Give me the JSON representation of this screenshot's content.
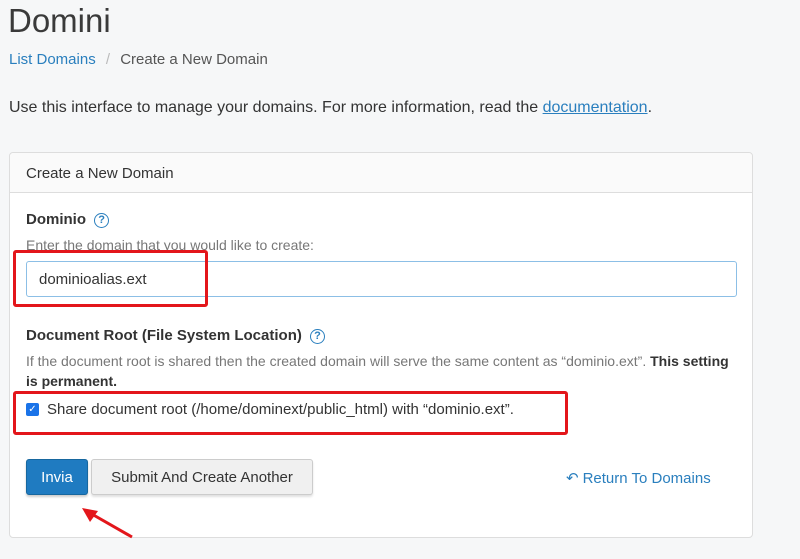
{
  "page": {
    "title": "Domini"
  },
  "breadcrumb": {
    "parent_label": "List Domains",
    "separator": "/",
    "current_label": "Create a New Domain"
  },
  "intro": {
    "text": "Use this interface to manage your domains. For more information, read the",
    "link_label": "documentation",
    "suffix": "."
  },
  "panel": {
    "heading": "Create a New Domain",
    "domain": {
      "label": "Dominio",
      "help_icon": "question-circle-icon",
      "help_text": "Enter the domain that you would like to create:",
      "value": "dominioalias.ext"
    },
    "docroot": {
      "label": "Document Root (File System Location)",
      "help_icon": "question-circle-icon",
      "help_text": "If the document root is shared then the created domain will serve the same content as “dominio.ext”.",
      "help_strong": "This setting is permanent.",
      "share_checked": true,
      "share_label": "Share document root (/home/dominext/public_html) with “dominio.ext”."
    },
    "actions": {
      "submit_label": "Invia",
      "submit_another_label": "Submit And Create Another",
      "return_label": "Return To Domains",
      "return_icon": "undo-arrow-icon"
    }
  },
  "colors": {
    "link": "#2a7fbe",
    "primary_button": "#1f7bc1",
    "annotation_red": "#e3161b"
  }
}
